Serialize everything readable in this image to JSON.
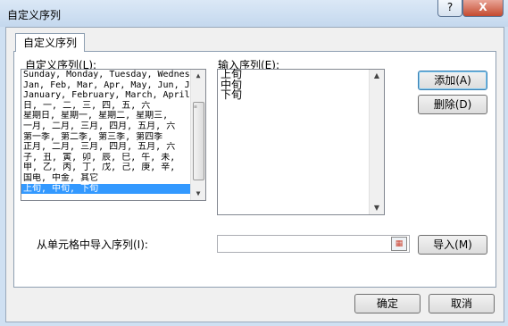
{
  "window": {
    "title": "自定义序列",
    "help_label": "?",
    "close_label": "X"
  },
  "tab": {
    "label": "自定义序列"
  },
  "custom_list": {
    "label": "自定义序列(L):",
    "items": [
      "Sunday, Monday, Tuesday, Wednes",
      "Jan, Feb, Mar, Apr, May, Jun, J",
      "January, February, March, April,",
      "日, 一, 二, 三, 四, 五, 六",
      "星期日, 星期一, 星期二, 星期三,",
      "一月, 二月, 三月, 四月, 五月, 六",
      "第一季, 第二季, 第三季, 第四季",
      "正月, 二月, 三月, 四月, 五月, 六",
      "子, 丑, 寅, 卯, 辰, 巳, 午, 未,",
      "甲, 乙, 丙, 丁, 戊, 己, 庚, 辛,",
      "国电, 中金, 其它",
      "上旬, 中旬, 下旬"
    ],
    "selected_index": 11
  },
  "input_sequence": {
    "label": "输入序列(E):",
    "lines": [
      "上旬",
      "中旬",
      "下旬"
    ]
  },
  "buttons": {
    "add": "添加(A)",
    "delete": "删除(D)",
    "import": "导入(M)",
    "ok": "确定",
    "cancel": "取消"
  },
  "import": {
    "label": "从单元格中导入序列(I):",
    "value": ""
  }
}
